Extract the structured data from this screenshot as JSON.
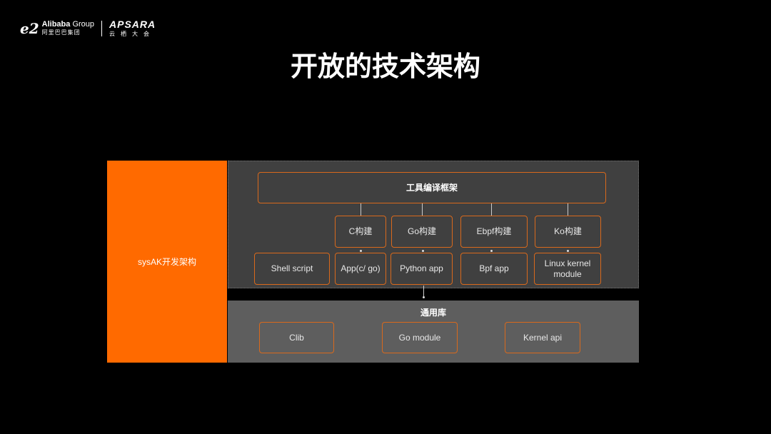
{
  "header": {
    "logo_mark": "e2",
    "company_en": "Alibaba",
    "company_en_suffix": "Group",
    "company_cn": "阿里巴巴集团",
    "event_en": "APSARA",
    "event_cn": "云栖大会"
  },
  "title": "开放的技术架构",
  "diagram": {
    "left_label": "sysAK开发架构",
    "framework_label": "工具编译框架",
    "build_nodes": [
      "C构建",
      "Go构建",
      "Ebpf构建",
      "Ko构建"
    ],
    "app_nodes": [
      "Shell script",
      "App(c/ go)",
      "Python app",
      "Bpf  app",
      "Linux kernel module"
    ],
    "library": {
      "title": "通用库",
      "items": [
        "Clib",
        "Go module",
        "Kernel api"
      ]
    }
  },
  "colors": {
    "accent": "#ff6a00",
    "box_border": "#d9691c",
    "top_panel": "#404040",
    "bottom_panel": "#5e5e5e"
  }
}
